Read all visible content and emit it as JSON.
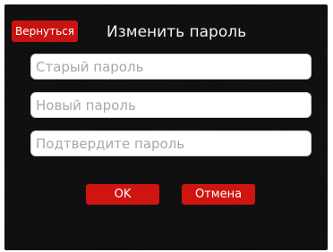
{
  "header": {
    "back_label": "Вернуться",
    "title": "Изменить пароль"
  },
  "form": {
    "old_password_placeholder": "Старый пароль",
    "new_password_placeholder": "Новый пароль",
    "confirm_password_placeholder": "Подтвердите пароль"
  },
  "actions": {
    "ok_label": "OK",
    "cancel_label": "Отмена"
  },
  "colors": {
    "background": "#0d0d0d",
    "accent": "#d01410",
    "field_background": "#ffffff",
    "placeholder_text": "#a8a8a8",
    "title_text": "#f2f2f2"
  }
}
